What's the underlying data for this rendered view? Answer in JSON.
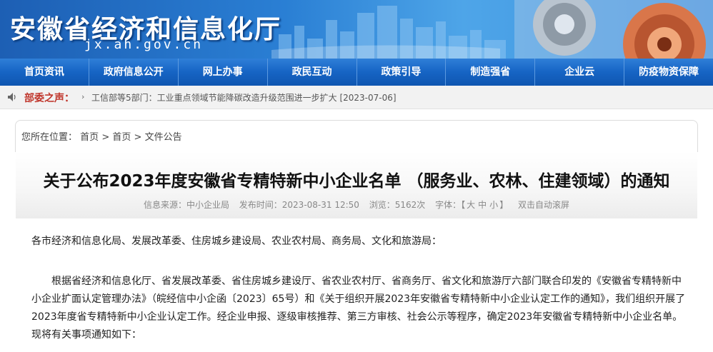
{
  "header": {
    "site_title": "安徽省经济和信息化厅",
    "site_domain": "jx.ah.gov.cn"
  },
  "nav": {
    "items": [
      "首页资讯",
      "政府信息公开",
      "网上办事",
      "政民互动",
      "政策引导",
      "制造强省",
      "企业云",
      "防疫物资保障"
    ]
  },
  "news_bar": {
    "label": "部委之声：",
    "link_text": "工信部等5部门：工业重点领域节能降碳改造升级范围进一步扩大 [2023-07-06]"
  },
  "breadcrumb": {
    "prefix": "您所在位置：",
    "items": [
      "首页",
      "首页",
      "文件公告"
    ],
    "sep": ">"
  },
  "article": {
    "title": "关于公布2023年度安徽省专精特新中小企业名单 （服务业、农林、住建领域）的通知",
    "source": "信息来源：中小企业局",
    "published": "发布时间：2023-08-31 12:50",
    "views": "浏览：5162次",
    "font_label": "字体：【",
    "font_large": "大",
    "font_medium": "中",
    "font_small": "小",
    "font_close": "】",
    "auto_scroll": "双击自动滚屏",
    "greeting": "各市经济和信息化局、发展改革委、住房城乡建设局、农业农村局、商务局、文化和旅游局：",
    "paragraph": "根据省经济和信息化厅、省发展改革委、省住房城乡建设厅、省农业农村厅、省商务厅、省文化和旅游厅六部门联合印发的《安徽省专精特新中小企业扩面认定管理办法》（皖经信中小企函〔2023〕65号）和《关于组织开展2023年安徽省专精特新中小企业认定工作的通知》，我们组织开展了2023年度省专精特新中小企业认定工作。经企业申报、逐级审核推荐、第三方审核、社会公示等程序，确定2023年安徽省专精特新中小企业名单。现将有关事项通知如下："
  },
  "colors": {
    "header_blue": "#1d5fb4",
    "nav_blue": "#1664c4",
    "news_label_red": "#c0362c"
  }
}
